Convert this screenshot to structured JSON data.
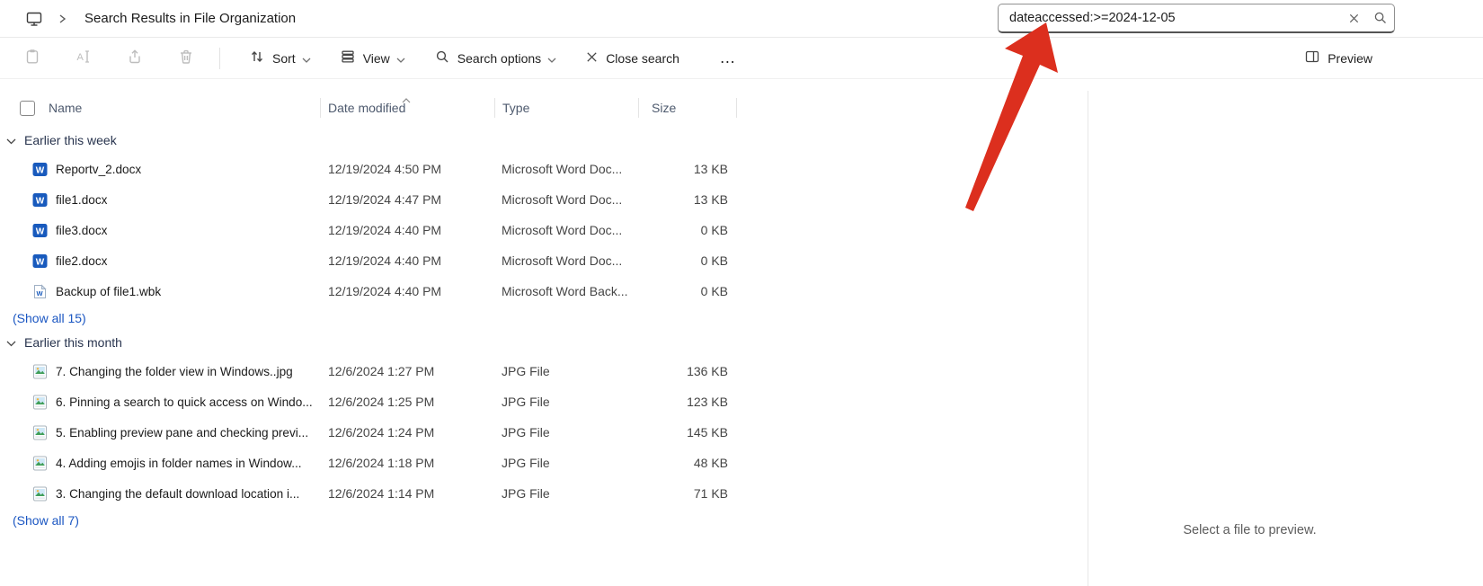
{
  "titlebar": {
    "title": "Search Results in File Organization",
    "search": {
      "query_misspelled_part": "dateaccessed",
      "query_rest": ":>=2024-12-05"
    }
  },
  "toolbar": {
    "sort_label": "Sort",
    "view_label": "View",
    "search_options_label": "Search options",
    "close_search_label": "Close search",
    "more_label": "…",
    "preview_label": "Preview"
  },
  "columns": {
    "name": "Name",
    "date_modified": "Date modified",
    "type": "Type",
    "size": "Size"
  },
  "groups": [
    {
      "label": "Earlier this week",
      "show_all_label": "(Show all 15)",
      "files": [
        {
          "name": "Reportv_2.docx",
          "date_modified": "12/19/2024 4:50 PM",
          "type": "Microsoft Word Doc...",
          "size": "13 KB",
          "icon": "word-file-icon"
        },
        {
          "name": "file1.docx",
          "date_modified": "12/19/2024 4:47 PM",
          "type": "Microsoft Word Doc...",
          "size": "13 KB",
          "icon": "word-file-icon"
        },
        {
          "name": "file3.docx",
          "date_modified": "12/19/2024 4:40 PM",
          "type": "Microsoft Word Doc...",
          "size": "0 KB",
          "icon": "word-file-icon"
        },
        {
          "name": "file2.docx",
          "date_modified": "12/19/2024 4:40 PM",
          "type": "Microsoft Word Doc...",
          "size": "0 KB",
          "icon": "word-file-icon"
        },
        {
          "name": "Backup of file1.wbk",
          "date_modified": "12/19/2024 4:40 PM",
          "type": "Microsoft Word Back...",
          "size": "0 KB",
          "icon": "word-backup-file-icon"
        }
      ]
    },
    {
      "label": "Earlier this month",
      "show_all_label": "(Show all 7)",
      "files": [
        {
          "name": "7. Changing the folder view in Windows..jpg",
          "date_modified": "12/6/2024 1:27 PM",
          "type": "JPG File",
          "size": "136 KB",
          "icon": "jpg-file-icon"
        },
        {
          "name": "6. Pinning a search to quick access on Windo...",
          "date_modified": "12/6/2024 1:25 PM",
          "type": "JPG File",
          "size": "123 KB",
          "icon": "jpg-file-icon"
        },
        {
          "name": "5. Enabling preview pane and checking previ...",
          "date_modified": "12/6/2024 1:24 PM",
          "type": "JPG File",
          "size": "145 KB",
          "icon": "jpg-file-icon"
        },
        {
          "name": "4. Adding emojis in folder names in Window...",
          "date_modified": "12/6/2024 1:18 PM",
          "type": "JPG File",
          "size": "48 KB",
          "icon": "jpg-file-icon"
        },
        {
          "name": "3. Changing the default download location i...",
          "date_modified": "12/6/2024 1:14 PM",
          "type": "JPG File",
          "size": "71 KB",
          "icon": "jpg-file-icon"
        }
      ]
    }
  ],
  "preview_pane": {
    "placeholder": "Select a file to preview."
  },
  "colors": {
    "link": "#1a56c2",
    "annotation_arrow": "#dc2f1e",
    "spellcheck_underline": "#e01515",
    "word_icon_blue": "#185abd"
  }
}
